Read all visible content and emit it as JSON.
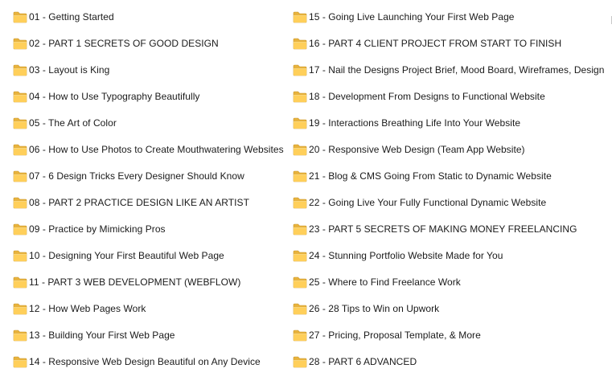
{
  "folder_icon": {
    "name": "folder-icon",
    "back_color": "#E8B33E",
    "front_color": "#FFCF5A",
    "edge_color": "#C99526"
  },
  "left_column": [
    "01 - Getting Started",
    "02 - PART 1 SECRETS OF GOOD DESIGN",
    "03 - Layout is King",
    "04 - How to Use Typography Beautifully",
    "05 - The Art of Color",
    "06 - How to Use Photos to Create Mouthwatering Websites",
    "07 - 6 Design Tricks Every Designer Should Know",
    "08 - PART 2 PRACTICE DESIGN LIKE AN ARTIST",
    "09 - Practice by Mimicking Pros",
    "10 - Designing Your First Beautiful Web Page",
    "11 - PART 3 WEB DEVELOPMENT (WEBFLOW)",
    "12 - How Web Pages Work",
    "13 - Building Your First Web Page",
    "14 - Responsive Web Design Beautiful on Any Device"
  ],
  "right_column": [
    "15 - Going Live Launching Your First Web Page",
    "16 - PART 4 CLIENT PROJECT FROM START TO FINISH",
    "17 - Nail the Designs Project Brief, Mood Board, Wireframes, Design",
    "18 - Development From Designs to Functional Website",
    "19 - Interactions Breathing Life Into Your Website",
    "20 - Responsive Web Design (Team App Website)",
    "21 - Blog & CMS Going From Static to Dynamic Website",
    "22 - Going Live Your Fully Functional Dynamic Website",
    "23 - PART 5 SECRETS OF MAKING MONEY FREELANCING",
    "24 - Stunning Portfolio Website Made for You",
    "25 - Where to Find Freelance Work",
    "26 - 28 Tips to Win on Upwork",
    "27 - Pricing, Proposal Template, & More",
    "28 - PART 6 ADVANCED"
  ]
}
